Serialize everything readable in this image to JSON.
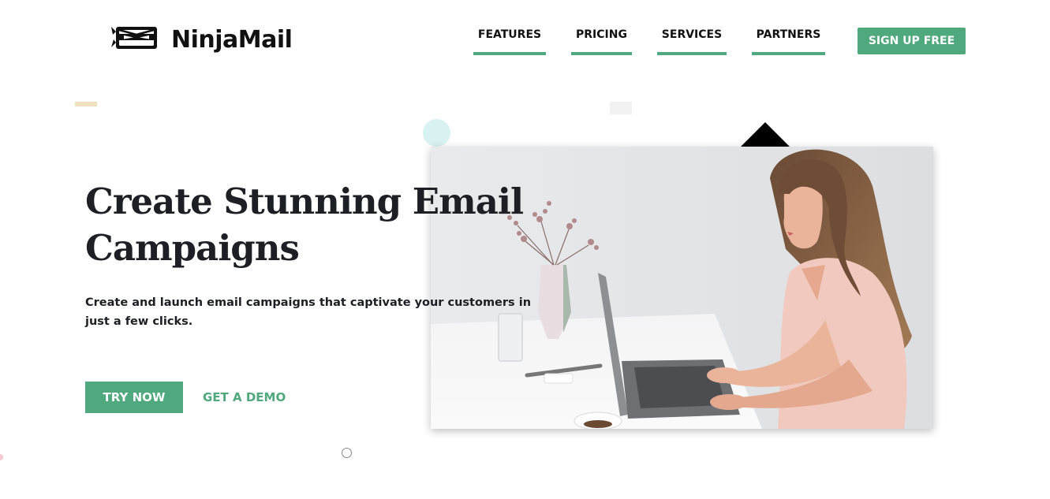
{
  "brand": {
    "name": "NinjaMail",
    "logo_icon": "ninja-envelope-icon"
  },
  "nav": {
    "items": [
      {
        "label": "FEATURES"
      },
      {
        "label": "PRICING"
      },
      {
        "label": "SERVICES"
      },
      {
        "label": "PARTNERS"
      }
    ],
    "signup_label": "SIGN UP FREE"
  },
  "hero": {
    "title": "Create Stunning Email Campaigns",
    "subtitle": "Create and launch email campaigns that captivate your customers in just a few clicks.",
    "primary_cta": "TRY NOW",
    "secondary_cta": "GET A DEMO",
    "image_subject": "woman typing on laptop at white desk"
  },
  "colors": {
    "accent": "#4fa87e",
    "text_dark": "#1d1f24",
    "decor_circle": "#d8f2f1",
    "decor_dash": "#ece3bd"
  }
}
